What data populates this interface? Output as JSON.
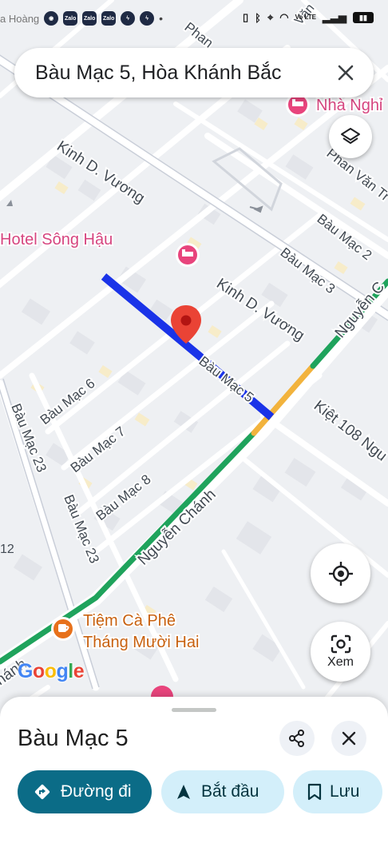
{
  "status_bar": {
    "carrier": "a Hoàng",
    "apps": [
      "Zalo",
      "Zalo",
      "Zalo"
    ],
    "more_dot": "•",
    "volte": "Vo LTE"
  },
  "search": {
    "text": "Bàu Mạc 5, Hòa Khánh Bắc"
  },
  "map_labels": {
    "hotel_song_hau": "Hotel Sông Hậu",
    "nha_nghi": "Nhà Nghỉ",
    "kinh_d_vuong_1": "Kinh D. Vương",
    "kinh_d_vuong_2": "Kinh D. Vương",
    "phan_van": "Phan Văn Tr",
    "phan_top": "Phan",
    "van": "Văn",
    "bau_mac_2": "Bàu Mạc 2",
    "bau_mac_3": "Bàu Mạc 3",
    "bau_mac_5": "Bàu Mạc 5",
    "bau_mac_6": "Bàu Mạc 6",
    "bau_mac_7": "Bàu Mạc 7",
    "bau_mac_8": "Bàu Mạc 8",
    "bau_mac_23_a": "Bàu Mạc 23",
    "bau_mac_23_b": "Bàu Mạc 23",
    "nguyen_chanh": "Nguyễn Chánh",
    "nguyen_top": "Nguyễn C",
    "kiet_108": "Kiệt 108 Ngu",
    "chanh_left": "hánh",
    "num_12": "12",
    "cafe_line1": "Tiệm Cà Phê",
    "cafe_line2": "Tháng Mười Hai"
  },
  "google_logo": [
    "G",
    "o",
    "o",
    "g",
    "l",
    "e"
  ],
  "lens_label": "Xem",
  "sheet": {
    "title": "Bàu Mạc 5",
    "directions": "Đường đi",
    "start": "Bắt đầu",
    "save": "Lưu"
  },
  "colors": {
    "route_blue": "#1a33e8",
    "traffic_green": "#1fa35c",
    "traffic_orange": "#f2b33d",
    "pin_red": "#ea4335",
    "hotel_pink": "#e8447c",
    "cafe_orange": "#e7711b",
    "primary_teal": "#0b6c87",
    "tonal_chip": "#d3effa"
  },
  "icons": {
    "layers": "layers-icon",
    "location": "my-location-icon",
    "lens": "lens-icon",
    "share": "share-icon",
    "close": "close-icon",
    "directions": "directions-icon",
    "navigation": "navigation-arrow-icon",
    "bookmark": "bookmark-icon"
  }
}
